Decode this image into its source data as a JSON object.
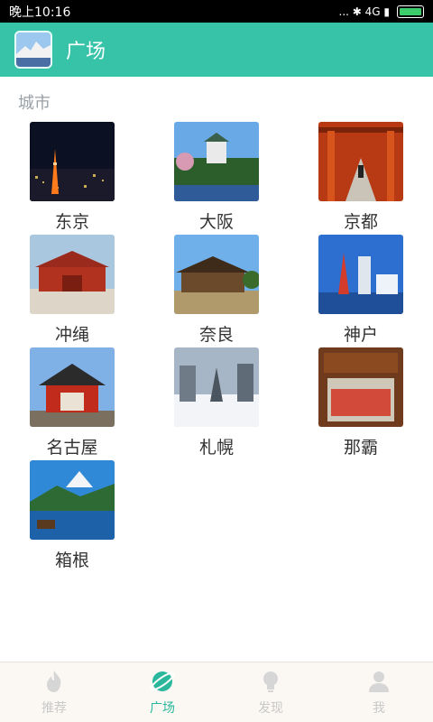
{
  "status_bar": {
    "time": "晚上10:16",
    "indicators": "... ✱ 4G ▮",
    "battery_level": 1.0
  },
  "app_bar": {
    "title": "广场"
  },
  "section": {
    "label": "城市"
  },
  "cities": [
    {
      "name": "东京"
    },
    {
      "name": "大阪"
    },
    {
      "name": "京都"
    },
    {
      "name": "冲绳"
    },
    {
      "name": "奈良"
    },
    {
      "name": "神户"
    },
    {
      "name": "名古屋"
    },
    {
      "name": "札幌"
    },
    {
      "name": "那霸"
    },
    {
      "name": "箱根"
    }
  ],
  "bottom_nav": [
    {
      "label": "推荐",
      "icon": "flame-icon",
      "active": false
    },
    {
      "label": "广场",
      "icon": "planet-icon",
      "active": true
    },
    {
      "label": "发现",
      "icon": "lightbulb-icon",
      "active": false
    },
    {
      "label": "我",
      "icon": "user-icon",
      "active": false
    }
  ],
  "colors": {
    "accent": "#37c3a8",
    "nav_active": "#2ab79b",
    "nav_inactive": "#c8c8c8"
  }
}
